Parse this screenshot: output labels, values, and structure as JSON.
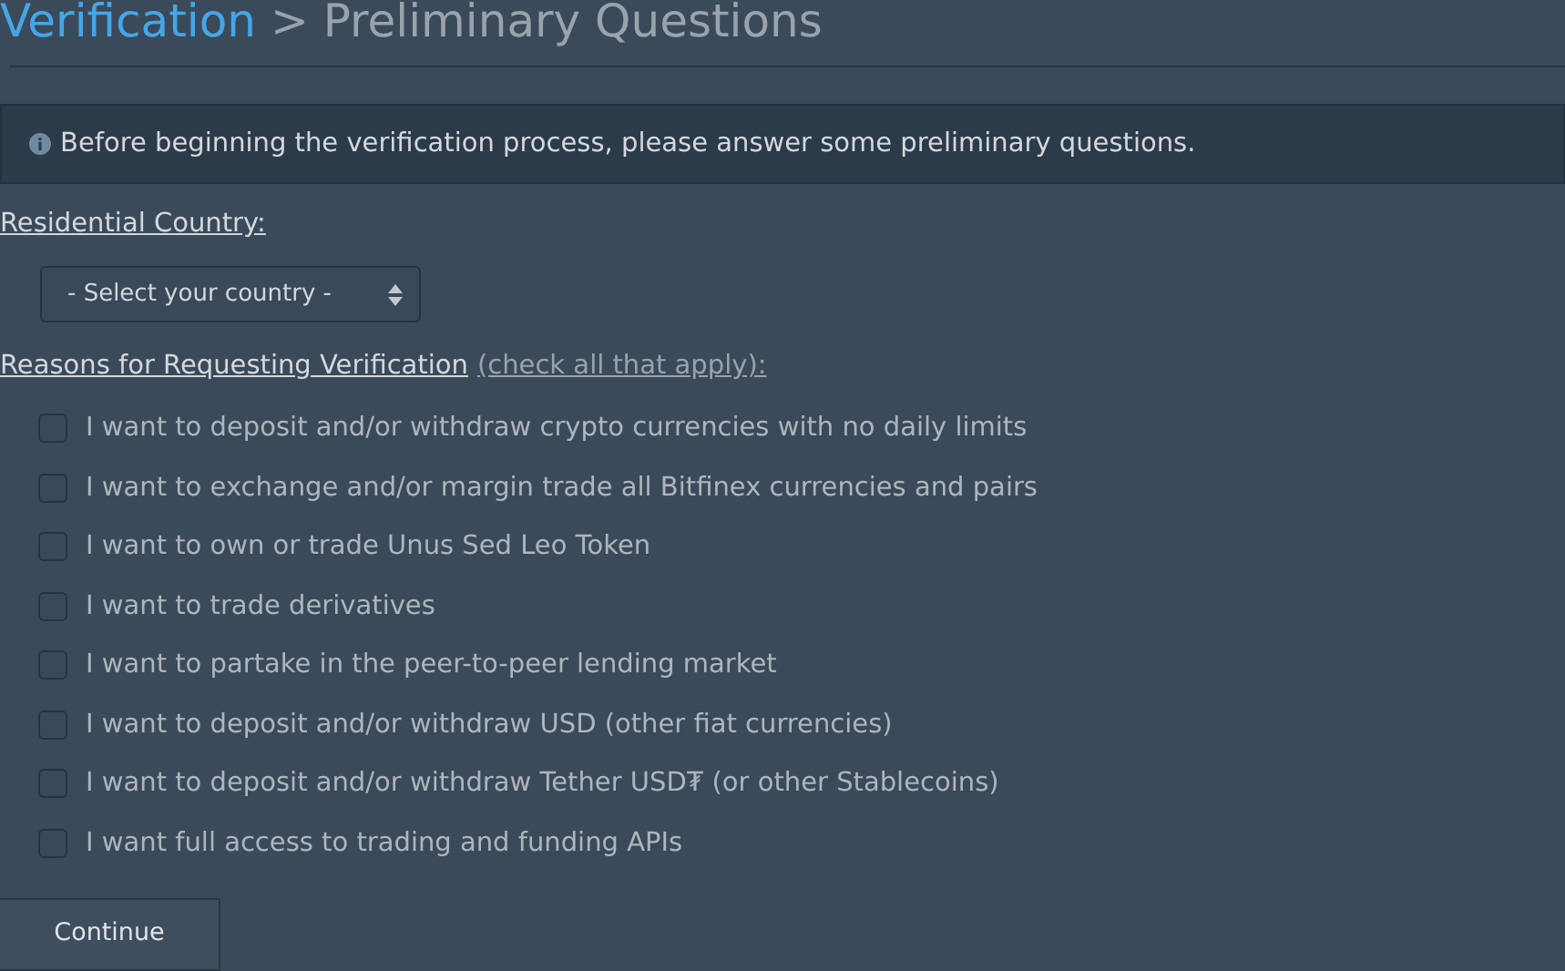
{
  "breadcrumb": {
    "link": "Verification",
    "separator": ">",
    "current": "Preliminary Questions"
  },
  "notice": {
    "text": "Before beginning the verification process, please answer some preliminary questions."
  },
  "country": {
    "label": "Residential Country:",
    "select": {
      "value": "- Select your country -"
    }
  },
  "reasons": {
    "label": "Reasons for Requesting Verification",
    "hint": "(check all that apply):",
    "options": [
      {
        "label": "I want to deposit and/or withdraw crypto currencies with no daily limits",
        "checked": false
      },
      {
        "label": "I want to exchange and/or margin trade all Bitfinex currencies and pairs",
        "checked": false
      },
      {
        "label": "I want to own or trade Unus Sed Leo Token",
        "checked": false
      },
      {
        "label": "I want to trade derivatives",
        "checked": false
      },
      {
        "label": "I want to partake in the peer-to-peer lending market",
        "checked": false
      },
      {
        "label": "I want to deposit and/or withdraw USD (other fiat currencies)",
        "checked": false
      },
      {
        "label": "I want to deposit and/or withdraw Tether USD₮ (or other Stablecoins)",
        "checked": false
      },
      {
        "label": "I want full access to trading and funding APIs",
        "checked": false
      }
    ]
  },
  "buttons": [
    {
      "label": "Continue"
    }
  ]
}
